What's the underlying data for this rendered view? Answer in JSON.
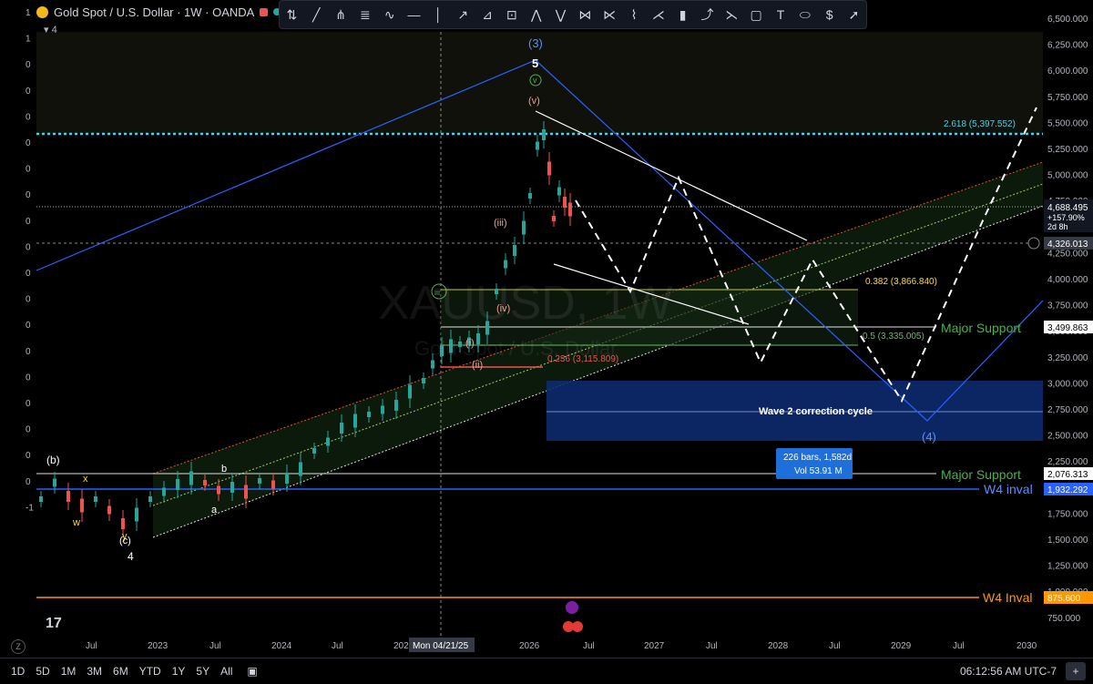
{
  "header": {
    "title": "Gold Spot / U.S. Dollar · 1W · OANDA",
    "layers": "4"
  },
  "toolbar_icons": [
    "cursor-icon",
    "trendline-icon",
    "pitchfork-icon",
    "fib-icon",
    "brush-icon",
    "hline-icon",
    "vline-icon",
    "ray-icon",
    "channel-icon",
    "long-position-icon",
    "elliott-impulse-icon",
    "elliott-correction-icon",
    "elliott-abc-icon",
    "elliott-wxy-icon",
    "zigzag-icon",
    "abcd-icon",
    "candle-icon",
    "path-icon",
    "wxyxz-icon",
    "rectangle-icon",
    "text-icon",
    "ellipse-icon",
    "price-label-icon",
    "arrow-icon"
  ],
  "watermark": {
    "symbol": "XAUUSD, 1W",
    "name": "Gold Spot / U.S. Dollar"
  },
  "price_axis": {
    "ticks": [
      "6,500.000",
      "6,250.000",
      "6,000.000",
      "5,750.000",
      "5,500.000",
      "5,250.000",
      "5,000.000",
      "4,750.000",
      "4,500.000",
      "4,250.000",
      "4,000.000",
      "3,750.000",
      "3,500.000",
      "3,250.000",
      "3,000.000",
      "2,750.000",
      "2,500.000",
      "2,250.000",
      "2,000.000",
      "1,750.000",
      "1,500.000",
      "1,250.000",
      "1,000.000",
      "750.000"
    ],
    "current_price": "4,688.495",
    "change": "+157.90%",
    "countdown": "2d 8h",
    "crosshair_price": "4,326.013",
    "label_3499": "3,499.863",
    "label_2076": "2,076.313",
    "label_1932": "1,932.292",
    "label_875": "875.600"
  },
  "left_axis_ticks": [
    "1",
    "1",
    "0",
    "0",
    "0",
    "0",
    "0",
    "0",
    "0",
    "0",
    "0",
    "0",
    "0",
    "0",
    "0",
    "0",
    "0",
    "0",
    "0",
    "-1"
  ],
  "time_axis": {
    "labels": [
      "Jul",
      "2023",
      "Jul",
      "2024",
      "Jul",
      "202",
      "Jul",
      "2026",
      "Jul",
      "2027",
      "Jul",
      "2028",
      "Jul",
      "2029",
      "Jul",
      "2030"
    ],
    "crosshair_date": "Mon 04/21/25"
  },
  "annotations": {
    "major_support_1": "Major Support",
    "major_support_2": "Major Support",
    "w4_inval_blue": "W4 inval",
    "w4_inval_orange": "W4 Inval",
    "fib_2618": "2.618 (5,397.552)",
    "fib_0382": "0.382 (3,866.840)",
    "fib_05": "0.5 (3,335.005)",
    "fib_0236": "0.236 (3,115.809)",
    "wave2_box": "Wave 2 correction cycle",
    "measure_bars": "226 bars, 1,582d",
    "measure_vol": "Vol 53.91 M",
    "wave3_label": "(3)",
    "wave4_label": "(4)",
    "wave_5": "5",
    "wave_v_circle": "v",
    "wave_v_paren": "(v)",
    "wave_iii_paren": "(iii)",
    "wave_iv_paren": "(iv)",
    "wave_iii_circle": "iii",
    "wave_b": "(b)",
    "wave_c": "(c)",
    "wave_4": "4",
    "wave_w": "w",
    "wave_x": "x",
    "wave_y": "y",
    "wave_a": "a",
    "wave_b_small": "b",
    "wave_i": "(i)",
    "wave_ii": "(ii)"
  },
  "bottom_bar": {
    "timeframes": [
      "1D",
      "5D",
      "1M",
      "3M",
      "6M",
      "YTD",
      "1Y",
      "5Y",
      "All"
    ],
    "clock": "06:12:56 AM UTC-7"
  },
  "colors": {
    "background": "#000000",
    "blue_wave": "#2962ff",
    "support_green": "#4caf50",
    "fib_cyan": "#4dd0e1",
    "w4_orange": "#ff9800",
    "box_navy": "#0d2a6e"
  }
}
